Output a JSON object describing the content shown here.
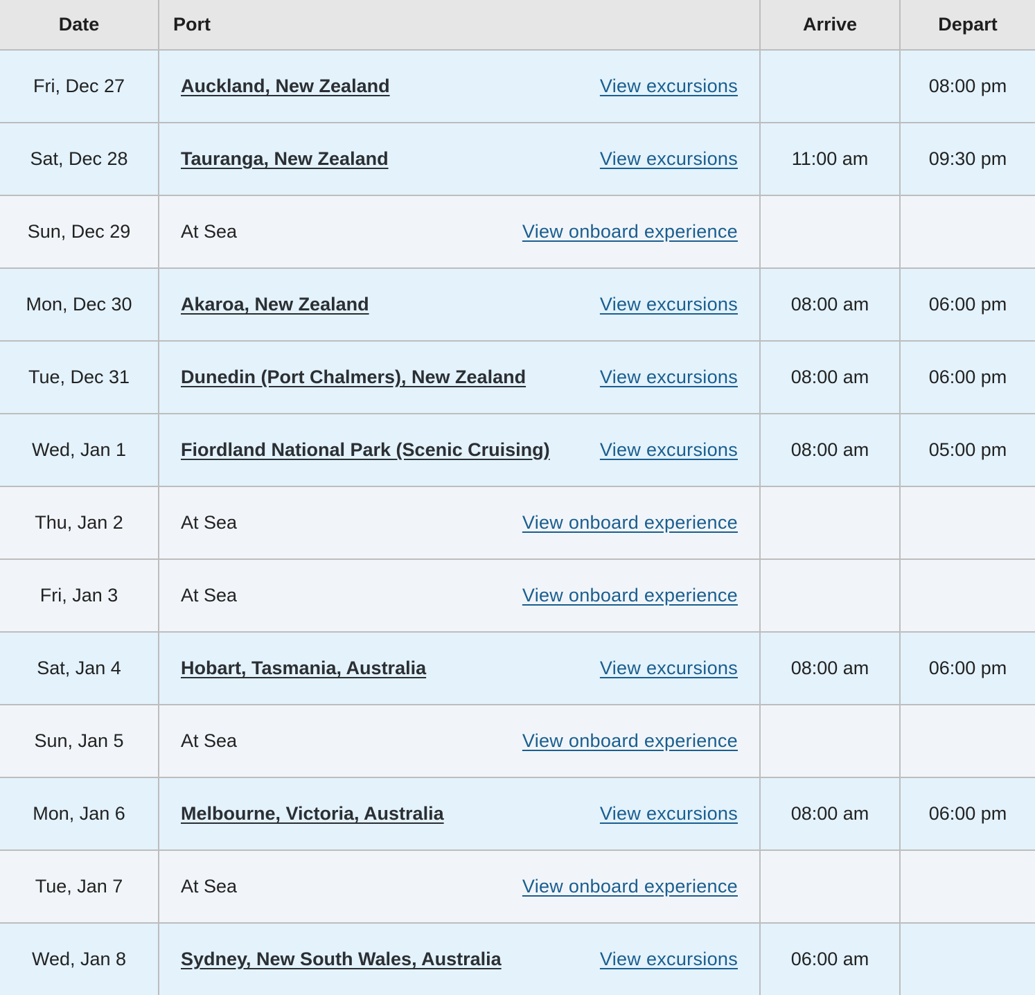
{
  "header": {
    "date": "Date",
    "port": "Port",
    "arrive": "Arrive",
    "depart": "Depart"
  },
  "rows": [
    {
      "type": "port",
      "date": "Fri, Dec 27",
      "port": "Auckland, New Zealand",
      "link": "View excursions",
      "arrive": "",
      "depart": "08:00 pm"
    },
    {
      "type": "port",
      "date": "Sat, Dec 28",
      "port": "Tauranga, New Zealand",
      "link": "View excursions",
      "arrive": "11:00 am",
      "depart": "09:30 pm"
    },
    {
      "type": "sea",
      "date": "Sun, Dec 29",
      "port": "At Sea",
      "link": "View onboard experience",
      "arrive": "",
      "depart": ""
    },
    {
      "type": "port",
      "date": "Mon, Dec 30",
      "port": "Akaroa, New Zealand",
      "link": "View excursions",
      "arrive": "08:00 am",
      "depart": "06:00 pm"
    },
    {
      "type": "port",
      "date": "Tue, Dec 31",
      "port": "Dunedin (Port Chalmers), New Zealand",
      "link": "View excursions",
      "arrive": "08:00 am",
      "depart": "06:00 pm"
    },
    {
      "type": "port",
      "date": "Wed, Jan 1",
      "port": "Fiordland National Park (Scenic Cruising)",
      "link": "View excursions",
      "arrive": "08:00 am",
      "depart": "05:00 pm"
    },
    {
      "type": "sea",
      "date": "Thu, Jan 2",
      "port": "At Sea",
      "link": "View onboard experience",
      "arrive": "",
      "depart": ""
    },
    {
      "type": "sea",
      "date": "Fri, Jan 3",
      "port": "At Sea",
      "link": "View onboard experience",
      "arrive": "",
      "depart": ""
    },
    {
      "type": "port",
      "date": "Sat, Jan 4",
      "port": "Hobart, Tasmania, Australia",
      "link": "View excursions",
      "arrive": "08:00 am",
      "depart": "06:00 pm"
    },
    {
      "type": "sea",
      "date": "Sun, Jan 5",
      "port": "At Sea",
      "link": "View onboard experience",
      "arrive": "",
      "depart": ""
    },
    {
      "type": "port",
      "date": "Mon, Jan 6",
      "port": "Melbourne, Victoria, Australia",
      "link": "View excursions",
      "arrive": "08:00 am",
      "depart": "06:00 pm"
    },
    {
      "type": "sea",
      "date": "Tue, Jan 7",
      "port": "At Sea",
      "link": "View onboard experience",
      "arrive": "",
      "depart": ""
    },
    {
      "type": "port",
      "date": "Wed, Jan 8",
      "port": "Sydney, New South Wales, Australia",
      "link": "View excursions",
      "arrive": "06:00 am",
      "depart": ""
    }
  ],
  "colors": {
    "header_bg": "#e6e6e6",
    "port_row_bg": "#e3f2fb",
    "sea_row_bg": "#f1f5f9",
    "link": "#1a5e8f",
    "border": "#bdbdbd"
  }
}
